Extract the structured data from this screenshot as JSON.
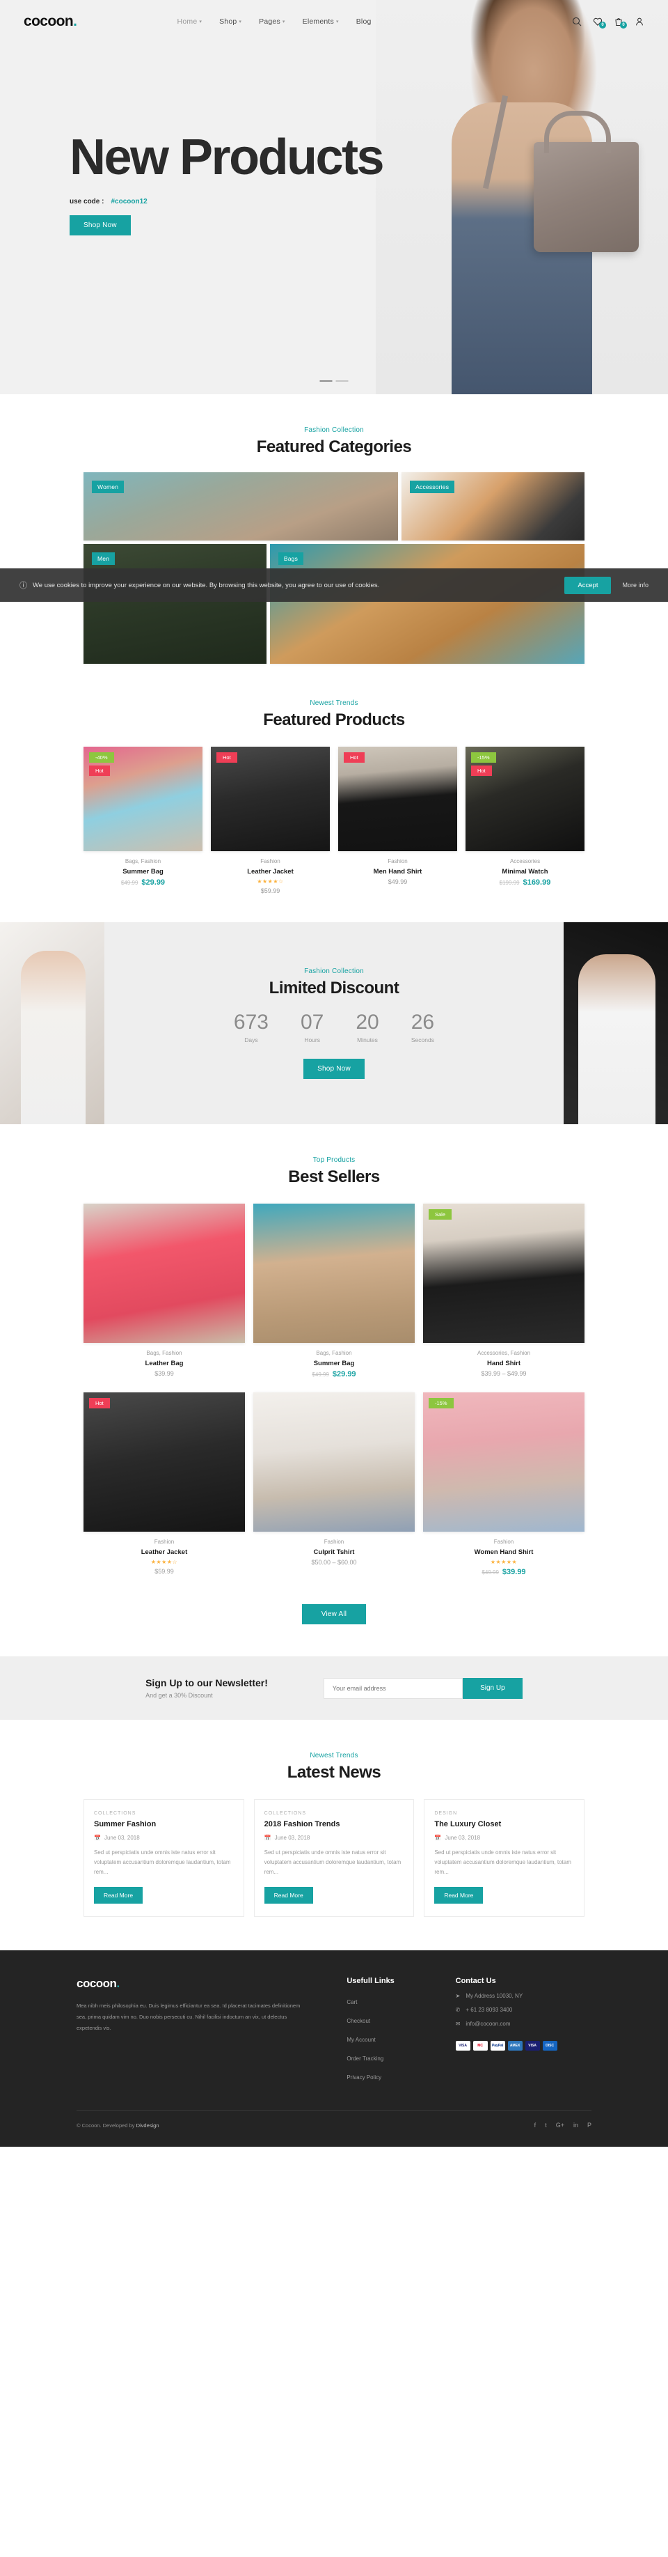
{
  "brand": {
    "name": "cocoon",
    "dot": "."
  },
  "nav": {
    "items": [
      {
        "label": "Home",
        "has_dropdown": true,
        "active": true
      },
      {
        "label": "Shop",
        "has_dropdown": true,
        "active": false
      },
      {
        "label": "Pages",
        "has_dropdown": true,
        "active": false
      },
      {
        "label": "Elements",
        "has_dropdown": true,
        "active": false
      },
      {
        "label": "Blog",
        "has_dropdown": false,
        "active": false
      }
    ],
    "icons": [
      {
        "name": "search-icon"
      },
      {
        "name": "wishlist-heart-icon",
        "count": "0"
      },
      {
        "name": "cart-bag-icon",
        "count": "0"
      },
      {
        "name": "user-account-icon"
      }
    ]
  },
  "hero": {
    "title": "New Products",
    "code_label": "use code :",
    "code_value": "#cocoon12",
    "cta": "Shop Now"
  },
  "featured_categories": {
    "eyebrow": "Fashion Collection",
    "heading": "Featured Categories",
    "items": [
      {
        "label": "Women"
      },
      {
        "label": "Accessories"
      },
      {
        "label": "Men"
      },
      {
        "label": "Bags"
      }
    ]
  },
  "cookie": {
    "message": "We use cookies to improve your experience on our website. By browsing this website, you agree to our use of cookies.",
    "accept": "Accept",
    "more": "More info"
  },
  "featured_products": {
    "eyebrow": "Newest Trends",
    "heading": "Featured Products",
    "items": [
      {
        "tags": [
          "-40%",
          "Hot"
        ],
        "tag_types": [
          "sale",
          "hot"
        ],
        "category": "Bags, Fashion",
        "name": "Summer Bag",
        "old_price": "$49.99",
        "new_price": "$29.99",
        "price": "",
        "stars": ""
      },
      {
        "tags": [
          "Hot"
        ],
        "tag_types": [
          "hot"
        ],
        "category": "Fashion",
        "name": "Leather Jacket",
        "old_price": "",
        "new_price": "",
        "price": "$59.99",
        "stars": "★★★★☆"
      },
      {
        "tags": [
          "Hot"
        ],
        "tag_types": [
          "hot"
        ],
        "category": "Fashion",
        "name": "Men Hand Shirt",
        "old_price": "",
        "new_price": "",
        "price": "$49.99",
        "stars": ""
      },
      {
        "tags": [
          "-15%",
          "Hot"
        ],
        "tag_types": [
          "sale",
          "hot"
        ],
        "category": "Accessories",
        "name": "Minimal Watch",
        "old_price": "$199.99",
        "new_price": "$169.99",
        "price": "",
        "stars": ""
      }
    ]
  },
  "limited_discount": {
    "eyebrow": "Fashion Collection",
    "heading": "Limited Discount",
    "countdown": [
      {
        "value": "673",
        "label": "Days"
      },
      {
        "value": "07",
        "label": "Hours"
      },
      {
        "value": "20",
        "label": "Minutes"
      },
      {
        "value": "26",
        "label": "Seconds"
      }
    ],
    "cta": "Shop Now"
  },
  "best_sellers": {
    "eyebrow": "Top Products",
    "heading": "Best Sellers",
    "view_all": "View All",
    "row1": [
      {
        "tags": [],
        "tag_types": [],
        "category": "Bags, Fashion",
        "name": "Leather Bag",
        "old_price": "",
        "new_price": "",
        "price": "$39.99",
        "stars": ""
      },
      {
        "tags": [],
        "tag_types": [],
        "category": "Bags, Fashion",
        "name": "Summer Bag",
        "old_price": "$49.99",
        "new_price": "$29.99",
        "price": "",
        "stars": ""
      },
      {
        "tags": [
          "Sale"
        ],
        "tag_types": [
          "sale"
        ],
        "category": "Accessories, Fashion",
        "name": "Hand Shirt",
        "old_price": "",
        "new_price": "",
        "price": "$39.99 – $49.99",
        "stars": ""
      }
    ],
    "row2": [
      {
        "tags": [
          "Hot"
        ],
        "tag_types": [
          "hot"
        ],
        "category": "Fashion",
        "name": "Leather Jacket",
        "old_price": "",
        "new_price": "",
        "price": "$59.99",
        "stars": "★★★★☆"
      },
      {
        "tags": [],
        "tag_types": [],
        "category": "Fashion",
        "name": "Culprit Tshirt",
        "old_price": "",
        "new_price": "",
        "price": "$50.00 – $60.00",
        "stars": ""
      },
      {
        "tags": [
          "-15%"
        ],
        "tag_types": [
          "sale"
        ],
        "category": "Fashion",
        "name": "Women Hand Shirt",
        "old_price": "$49.99",
        "new_price": "$39.99",
        "price": "",
        "stars": "★★★★★"
      }
    ]
  },
  "newsletter": {
    "title": "Sign Up to our Newsletter!",
    "subtitle": "And get a 30% Discount",
    "placeholder": "Your email address",
    "button": "Sign Up"
  },
  "latest_news": {
    "eyebrow": "Newest Trends",
    "heading": "Latest News",
    "items": [
      {
        "category": "COLLECTIONS",
        "title": "Summer Fashion",
        "date": "June 03, 2018",
        "excerpt": "Sed ut perspiciatis unde omnis iste natus error sit voluptatem accusantium doloremque laudantium, totam rem...",
        "button": "Read More"
      },
      {
        "category": "COLLECTIONS",
        "title": "2018 Fashion Trends",
        "date": "June 03, 2018",
        "excerpt": "Sed ut perspiciatis unde omnis iste natus error sit voluptatem accusantium doloremque laudantium, totam rem...",
        "button": "Read More"
      },
      {
        "category": "DESIGN",
        "title": "The Luxury Closet",
        "date": "June 03, 2018",
        "excerpt": "Sed ut perspiciatis unde omnis iste natus error sit voluptatem accusantium doloremque laudantium, totam rem...",
        "button": "Read More"
      }
    ]
  },
  "footer": {
    "logo": "cocoon",
    "about": "Mea nibh meis philosophia eu. Duis legimus efficiantur ea sea. Id placerat tacimates definitionem sea, prima quidam vim no. Duo nobis persecuti cu. Nihil facilisi indoctum an vix, ut delectus expetendis vis.",
    "links_heading": "Usefull Links",
    "links": [
      "Cart",
      "Checkout",
      "My Account",
      "Order Tracking",
      "Privacy Policy"
    ],
    "contact_heading": "Contact Us",
    "contact": [
      {
        "icon": "location-pin-icon",
        "text": "My Address 10030, NY"
      },
      {
        "icon": "phone-icon",
        "text": "+ 61 23 8093 3400"
      },
      {
        "icon": "email-icon",
        "text": "info@cocoon.com"
      }
    ],
    "cards": [
      "VISA",
      "MC",
      "PayPal",
      "AMEX",
      "VISA",
      "DISC"
    ],
    "copyright_prefix": "© Cocoon. Developed by",
    "copyright_author": "Divdesign",
    "socials": [
      "f",
      "t",
      "G+",
      "in",
      "P"
    ]
  },
  "colors": {
    "accent": "#17a2a2",
    "hot": "#ef3e56",
    "sale": "#8dc63f",
    "star": "#fbb13c",
    "footer_bg": "#242424"
  }
}
